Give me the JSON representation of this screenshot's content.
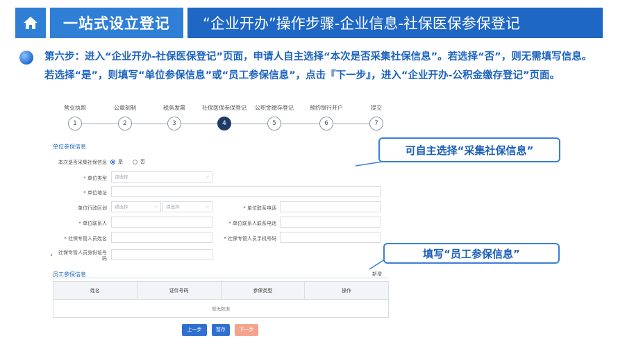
{
  "header": {
    "title": "一站式设立登记",
    "subtitle": "“企业开办”操作步骤-企业信息-社保医保参保登记",
    "icon": "home-icon"
  },
  "instruction": {
    "text": "第六步：进入“企业开办-社保医保登记”页面，申请人自主选择“本次是否采集社保信息”。若选择“否”，则无需填写信息。若选择“是”，则填写“单位参保信息”或“员工参保信息”，点击『下一步』，进入“企业开办-公积金缴存登记”页面。"
  },
  "stepper": {
    "active_index": 4,
    "steps": [
      {
        "label": "营业执照",
        "number": "1"
      },
      {
        "label": "公章刻制",
        "number": "2"
      },
      {
        "label": "税务发票",
        "number": "3"
      },
      {
        "label": "社保医保参保登记",
        "number": "4"
      },
      {
        "label": "公积金缴存登记",
        "number": "5"
      },
      {
        "label": "预约银行开户",
        "number": "6"
      },
      {
        "label": "提交",
        "number": "7"
      }
    ]
  },
  "form": {
    "unit_section_title": "单位参保信息",
    "collect_label": "本次是否采集社保信息",
    "option_yes": "是",
    "option_no": "否",
    "unit_type_label": "* 单位类型",
    "unit_type_placeholder": "请选择",
    "unit_address_label": "* 单位地址",
    "region_label": "单位行政区划",
    "region_placeholder_1": "请选择",
    "region_placeholder_2": "请选择",
    "unit_phone_label": "* 单位联系电话",
    "unit_contact_label": "* 单位联系人",
    "unit_contact_phone_label": "* 单位联系人联系电话",
    "ss_manager_name_label": "* 社保专管人员姓名",
    "ss_manager_mobile_label": "* 社保专管人员手机号码",
    "ss_manager_id_label_1": "社保专管人员身份证号",
    "ss_manager_id_label_2": "码",
    "employee_section_title": "员工参保信息",
    "add_link": "新增",
    "table_headers": [
      "姓名",
      "证件号码",
      "参保类型",
      "操作"
    ],
    "table_empty": "暂无数据"
  },
  "buttons": {
    "prev": "上一步",
    "save": "暂存",
    "next": "下一步"
  },
  "callouts": {
    "collect": "可自主选择“采集社保信息”",
    "employee": "填写“员工参保信息”"
  },
  "colors": {
    "primary": "#2f7fd6",
    "dark_primary": "#1f67c4",
    "active_step": "#1f3b66",
    "next_button": "#f5a38c"
  }
}
